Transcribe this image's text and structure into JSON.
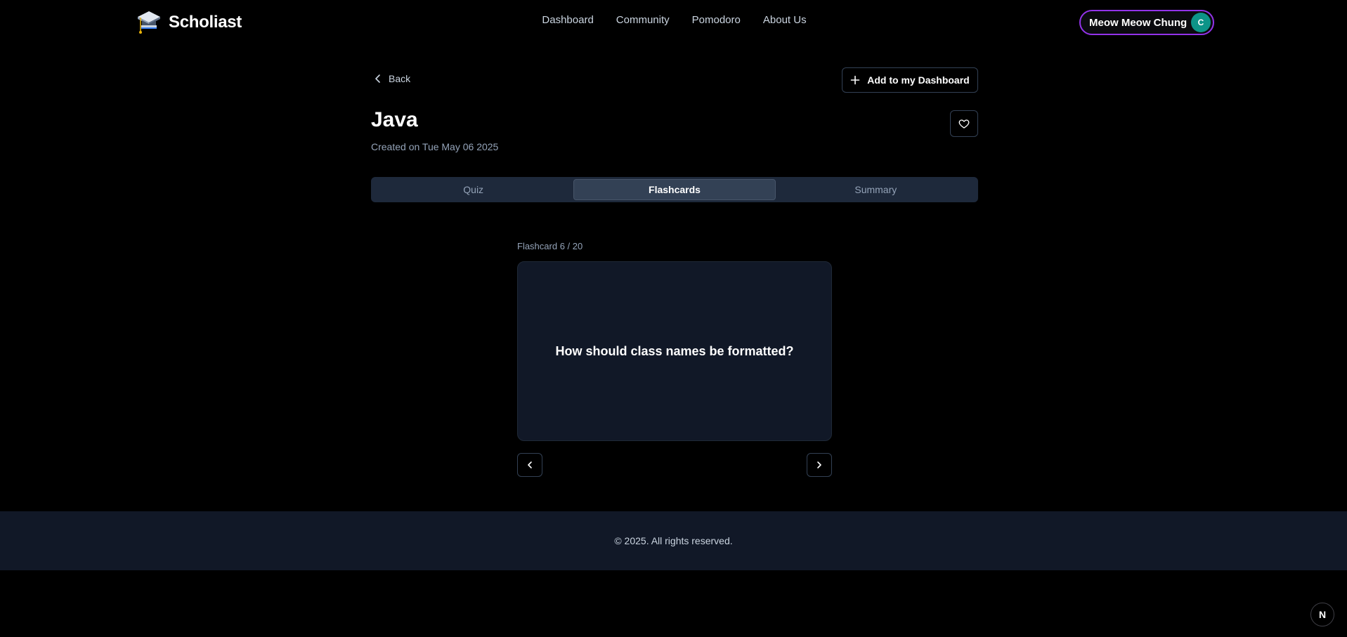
{
  "header": {
    "brand": "Scholiast",
    "nav": [
      {
        "label": "Dashboard"
      },
      {
        "label": "Community"
      },
      {
        "label": "Pomodoro"
      },
      {
        "label": "About Us"
      }
    ],
    "user": {
      "name": "Meow Meow Chung",
      "initial": "C"
    }
  },
  "page": {
    "back_label": "Back",
    "add_label": "Add to my Dashboard",
    "title": "Java",
    "created": "Created on Tue May 06 2025",
    "tabs": [
      {
        "label": "Quiz"
      },
      {
        "label": "Flashcards",
        "active": true
      },
      {
        "label": "Summary"
      }
    ]
  },
  "flashcard": {
    "counter": "Flashcard 6 / 20",
    "question": "How should class names be formatted?"
  },
  "footer": {
    "text": "© 2025. All rights reserved."
  },
  "badge": {
    "label": "N"
  },
  "colors": {
    "background": "#000000",
    "card": "#111827",
    "tab_bar": "#1e293b",
    "user_border": "#9333ea",
    "avatar": "#0d9488"
  },
  "icons": [
    "graduation-cap-logo",
    "chevron-left-icon",
    "plus-icon",
    "heart-icon",
    "chevron-right-icon"
  ]
}
